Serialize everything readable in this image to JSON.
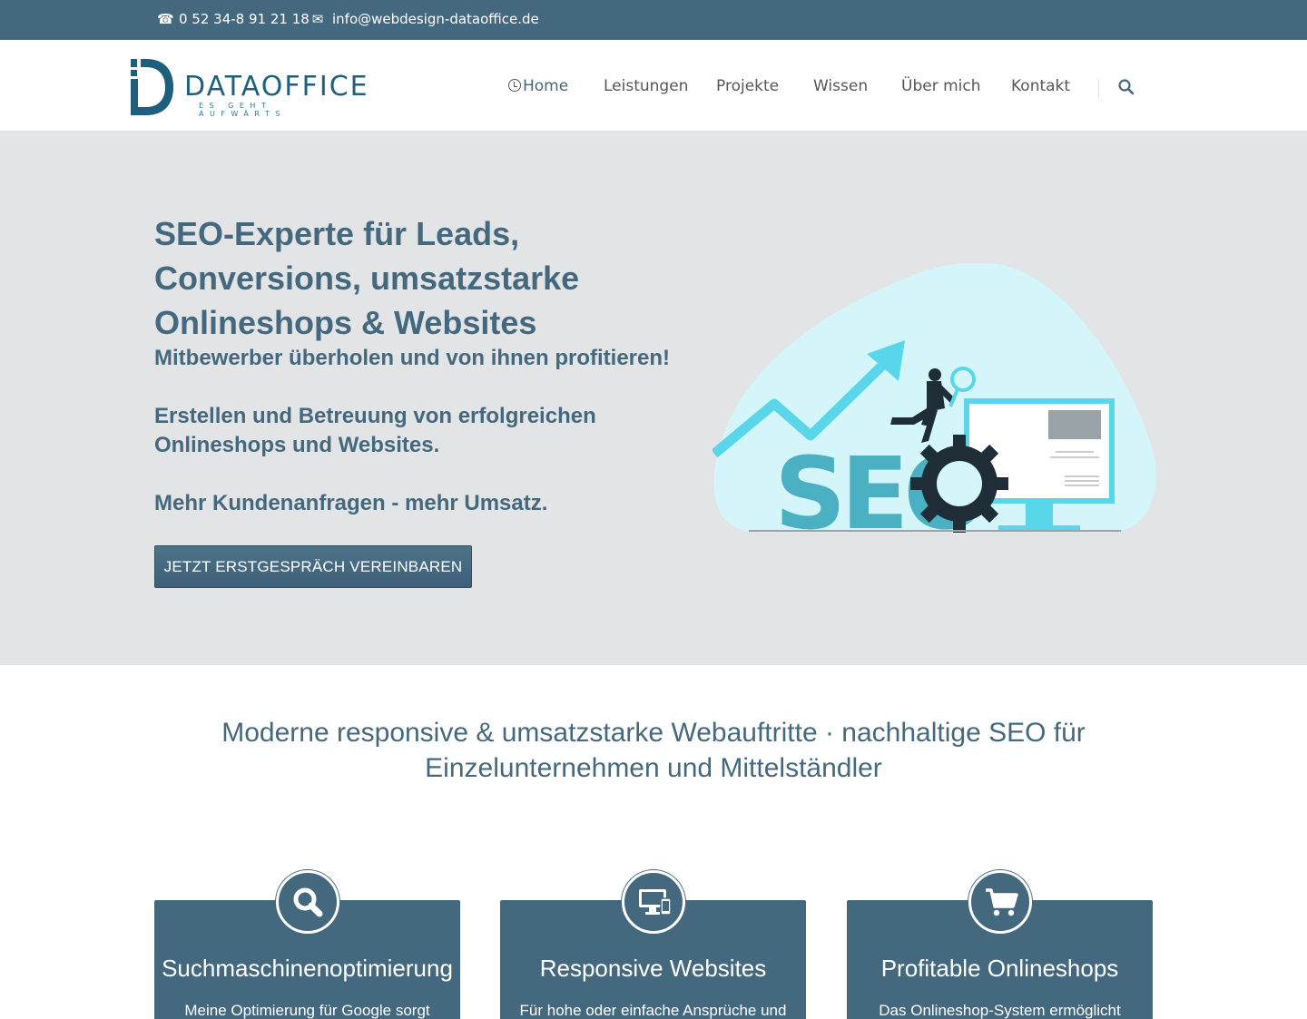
{
  "topbar": {
    "phone": "0 52 34-8 91 21 18",
    "email": "info@webdesign-dataoffice.de",
    "phone_icon": "phone-icon",
    "email_icon": "envelope-icon"
  },
  "header": {
    "logo_name": "DATAOFFICE",
    "logo_tagline": "ES GEHT AUFWÄRTS",
    "nav": [
      "Home",
      "Leistungen",
      "Projekte",
      "Wissen",
      "Über mich",
      "Kontakt"
    ],
    "search_icon": "search-icon"
  },
  "hero": {
    "headline": "SEO-Experte für Leads, Conversions, umsatzstarke Onlineshops & Websites",
    "sub1": "Mitbewerber überholen und von ihnen profitieren!",
    "sub2": "Erstellen und Betreuung von erfolgreichen Onlineshops und Websites.",
    "sub3": "Mehr Kundenanfragen - mehr Umsatz.",
    "cta": "JETZT ERSTGESPRÄCH VEREINBAREN",
    "illustration_text": "SEO"
  },
  "intro": "Moderne responsive & umsatzstarke Webauftritte · nachhaltige SEO für Einzelunternehmen und Mittelständler",
  "cards": [
    {
      "title": "Suchmaschinenoptimierung",
      "text": "Meine Optimierung für Google sorgt",
      "icon": "search-icon"
    },
    {
      "title": "Responsive Websites",
      "text": "Für hohe oder einfache Ansprüche und",
      "icon": "devices-icon"
    },
    {
      "title": "Profitable Onlineshops",
      "text": "Das Onlineshop-System ermöglicht",
      "icon": "cart-icon"
    }
  ],
  "colors": {
    "primary": "#44697f",
    "hero_bg": "#e3e4e6",
    "logo_blue": "#1d5f7d",
    "illustration_teal": "#4ab0c2",
    "illustration_light": "#d4f6fb"
  }
}
